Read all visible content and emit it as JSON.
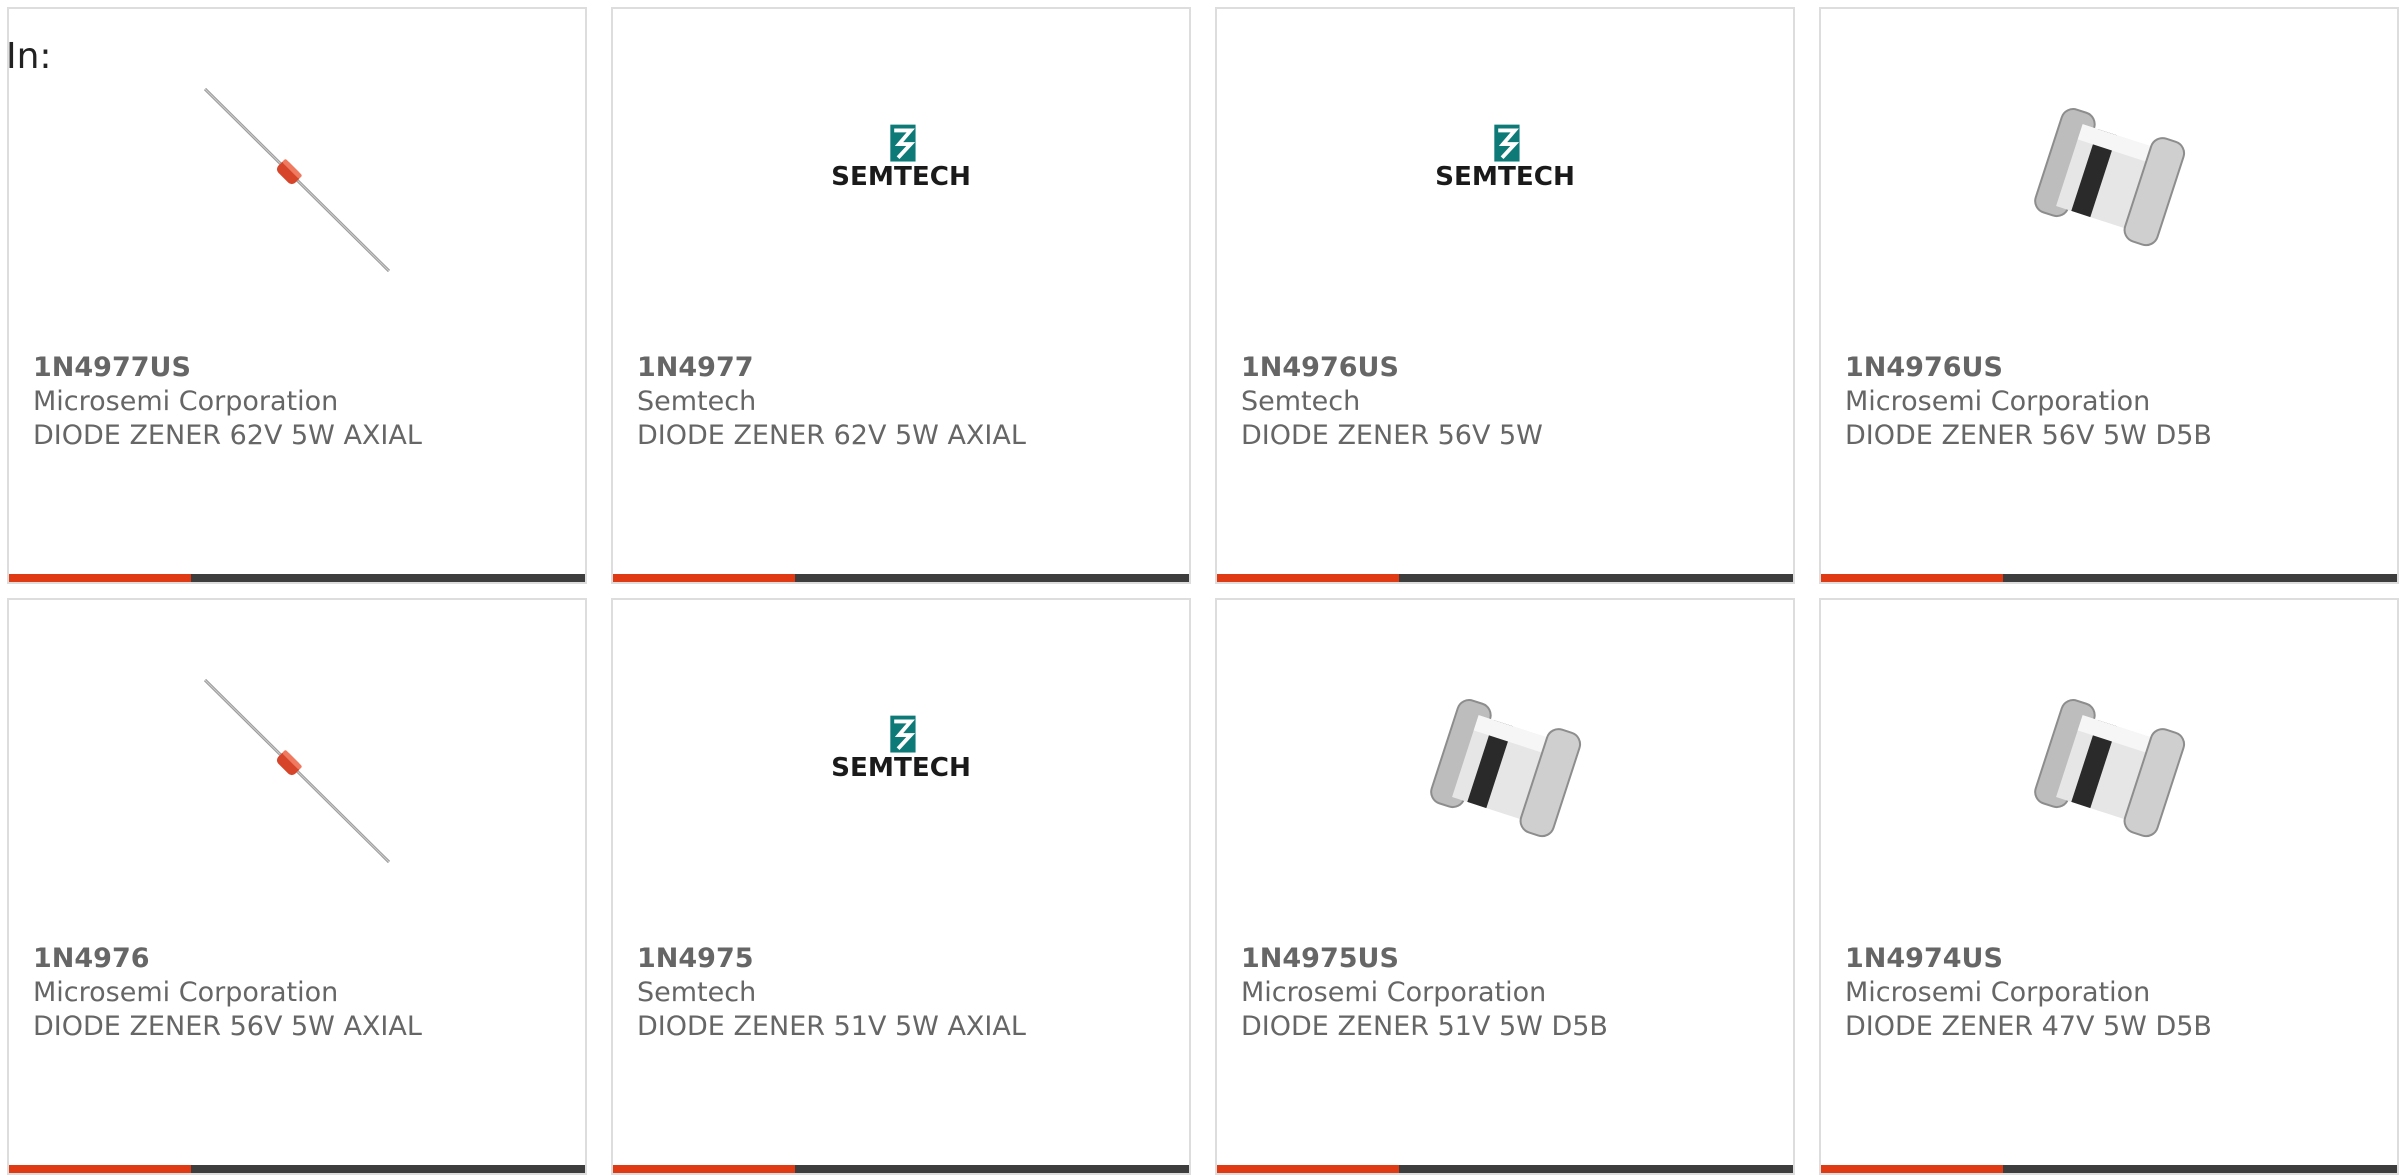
{
  "filter": {
    "label": "In:"
  },
  "colors": {
    "accent": "#e03a14",
    "bar": "#3d3d3d",
    "text": "#666666",
    "border": "#dddddd",
    "semtech_teal": "#0e7a78"
  },
  "products": [
    {
      "part_number": "1N4977US",
      "manufacturer": "Microsemi Corporation",
      "description": "DIODE ZENER 62V 5W AXIAL",
      "image": "axial-diode"
    },
    {
      "part_number": "1N4977",
      "manufacturer": "Semtech",
      "description": "DIODE ZENER 62V 5W AXIAL",
      "image": "semtech-logo",
      "logo_text": "SEMTECH"
    },
    {
      "part_number": "1N4976US",
      "manufacturer": "Semtech",
      "description": "DIODE ZENER 56V 5W",
      "image": "semtech-logo",
      "logo_text": "SEMTECH"
    },
    {
      "part_number": "1N4976US",
      "manufacturer": "Microsemi Corporation",
      "description": "DIODE ZENER 56V 5W D5B",
      "image": "d5b-package"
    },
    {
      "part_number": "1N4976",
      "manufacturer": "Microsemi Corporation",
      "description": "DIODE ZENER 56V 5W AXIAL",
      "image": "axial-diode"
    },
    {
      "part_number": "1N4975",
      "manufacturer": "Semtech",
      "description": "DIODE ZENER 51V 5W AXIAL",
      "image": "semtech-logo",
      "logo_text": "SEMTECH"
    },
    {
      "part_number": "1N4975US",
      "manufacturer": "Microsemi Corporation",
      "description": "DIODE ZENER 51V 5W D5B",
      "image": "d5b-package"
    },
    {
      "part_number": "1N4974US",
      "manufacturer": "Microsemi Corporation",
      "description": "DIODE ZENER 47V 5W D5B",
      "image": "d5b-package"
    }
  ]
}
